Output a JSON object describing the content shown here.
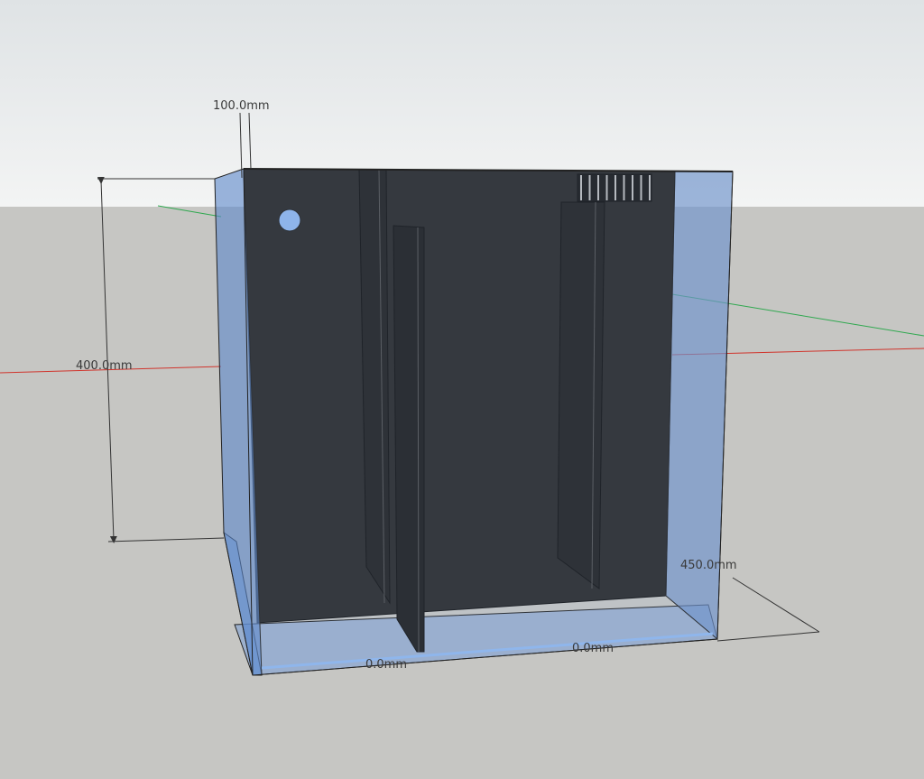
{
  "viewport": {
    "sky_color": "#eef0f1",
    "ground_color": "#c6c6c3"
  },
  "model": {
    "glass_color": "#5b87c9",
    "panel_color": "#2a2a2a",
    "hole_color": "#8fb6ec"
  },
  "axes": {
    "red_axis_color": "#d0342c",
    "green_axis_color": "#2fa84f"
  },
  "dimensions": {
    "top_offset": "100.0mm",
    "height": "400.0mm",
    "depth": "450.0mm",
    "bottom_left": "0.0mm",
    "bottom_right": "0.0mm"
  }
}
